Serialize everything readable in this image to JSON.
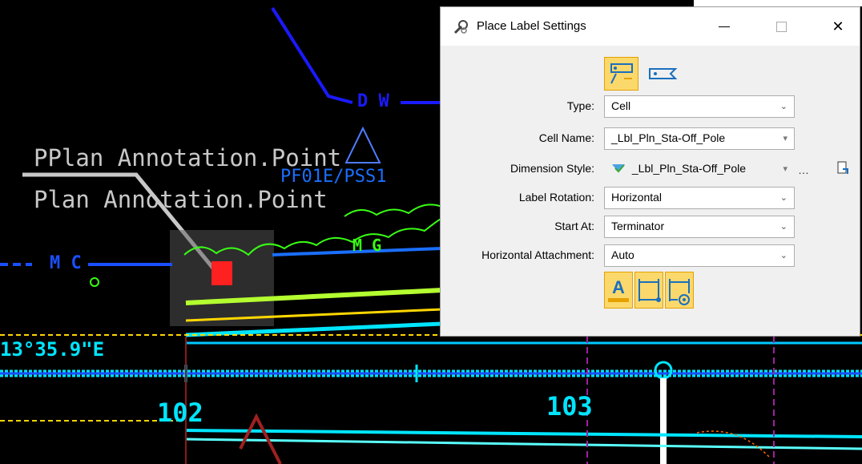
{
  "canvas": {
    "annotation_line1": "PPlan Annotation.Point",
    "annotation_line2": "Plan Annotation.Point",
    "blue_code": "PF01E/PSS1",
    "dw_label": "D W",
    "mc_label": "M C",
    "mg_label": "M G",
    "bearing_text": "13°35.9\"E",
    "station_102": "102",
    "station_103": "103",
    "colors": {
      "background": "#000000",
      "annotation": "#c8c8c8",
      "blue_line": "#1a1aff",
      "cyan": "#00e5ff",
      "green": "#39ff14",
      "yellow": "#ffd700",
      "red": "#ff2020"
    }
  },
  "dialog": {
    "title": "Place Label Settings",
    "title_icon": "settings-wrench-icon",
    "window_controls": {
      "minimize": "minimize-icon",
      "maximize": "maximize-icon",
      "close": "close-icon",
      "close_glyph": "✕"
    },
    "modes": [
      {
        "name": "label-with-leader-icon",
        "active": true
      },
      {
        "name": "label-without-leader-icon",
        "active": false
      }
    ],
    "fields": {
      "type": {
        "label": "Type:",
        "value": "Cell"
      },
      "cell_name": {
        "label": "Cell Name:",
        "value": "_Lbl_Pln_Sta-Off_Pole"
      },
      "dimension_style": {
        "label": "Dimension Style:",
        "value": "_Lbl_Pln_Sta-Off_Pole",
        "extra": "…"
      },
      "label_rotation": {
        "label": "Label Rotation:",
        "value": "Horizontal"
      },
      "start_at": {
        "label": "Start At:",
        "value": "Terminator"
      },
      "horizontal_attachment": {
        "label": "Horizontal Attachment:",
        "value": "Auto"
      }
    },
    "chevron": "⌄",
    "tools": [
      {
        "name": "text-style-icon",
        "glyph": "A"
      },
      {
        "name": "dimension-line-icon"
      },
      {
        "name": "dimension-at-icon"
      }
    ],
    "accent": "#fbd86b"
  }
}
